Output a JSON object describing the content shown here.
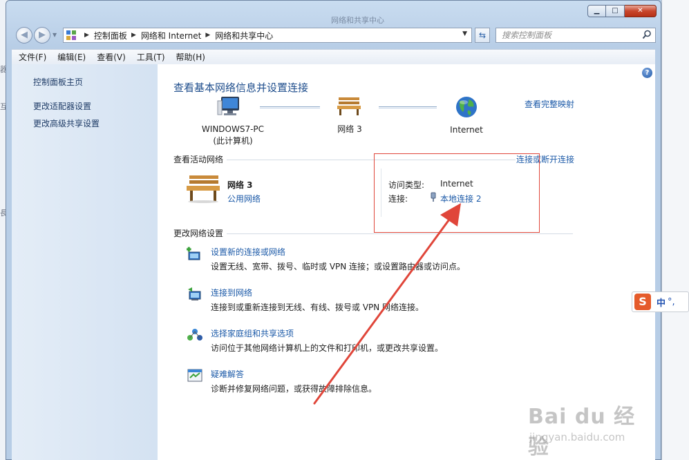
{
  "window": {
    "caption": "网络和共享中心"
  },
  "address_bar": {
    "crumbs": [
      "控制面板",
      "网络和 Internet",
      "网络和共享中心"
    ],
    "search_placeholder": "搜索控制面板"
  },
  "menu": [
    "文件(F)",
    "编辑(E)",
    "查看(V)",
    "工具(T)",
    "帮助(H)"
  ],
  "sidebar": {
    "home": "控制面板主页",
    "links": [
      "更改适配器设置",
      "更改高级共享设置"
    ]
  },
  "main": {
    "title": "查看基本网络信息并设置连接",
    "view_full_map": "查看完整映射",
    "map": {
      "computer_name": "WINDOWS7-PC",
      "computer_sub": "(此计算机)",
      "network": "网络  3",
      "internet": "Internet"
    },
    "active_networks": {
      "heading": "查看活动网络",
      "connect_disconnect": "连接或断开连接",
      "network_name": "网络  3",
      "network_type": "公用网络",
      "access_type_label": "访问类型:",
      "access_type_value": "Internet",
      "connections_label": "连接:",
      "connection_value": "本地连接 2"
    },
    "change_settings": {
      "heading": "更改网络设置",
      "tasks": [
        {
          "title": "设置新的连接或网络",
          "desc": "设置无线、宽带、拨号、临时或 VPN 连接；或设置路由器或访问点。"
        },
        {
          "title": "连接到网络",
          "desc": "连接到或重新连接到无线、有线、拨号或 VPN 网络连接。"
        },
        {
          "title": "选择家庭组和共享选项",
          "desc": "访问位于其他网络计算机上的文件和打印机，或更改共享设置。"
        },
        {
          "title": "疑难解答",
          "desc": "诊断并修复网络问题，或获得故障排除信息。"
        }
      ]
    }
  },
  "ime": {
    "lang": "中",
    "punct": "°,"
  },
  "watermark": {
    "brand": "Bai du 经验",
    "url": "jingyan.baidu.com"
  },
  "colors": {
    "link": "#1c5aa8",
    "title": "#1e4d8c",
    "highlight_box": "#e0463a",
    "arrow": "#e0463a"
  }
}
